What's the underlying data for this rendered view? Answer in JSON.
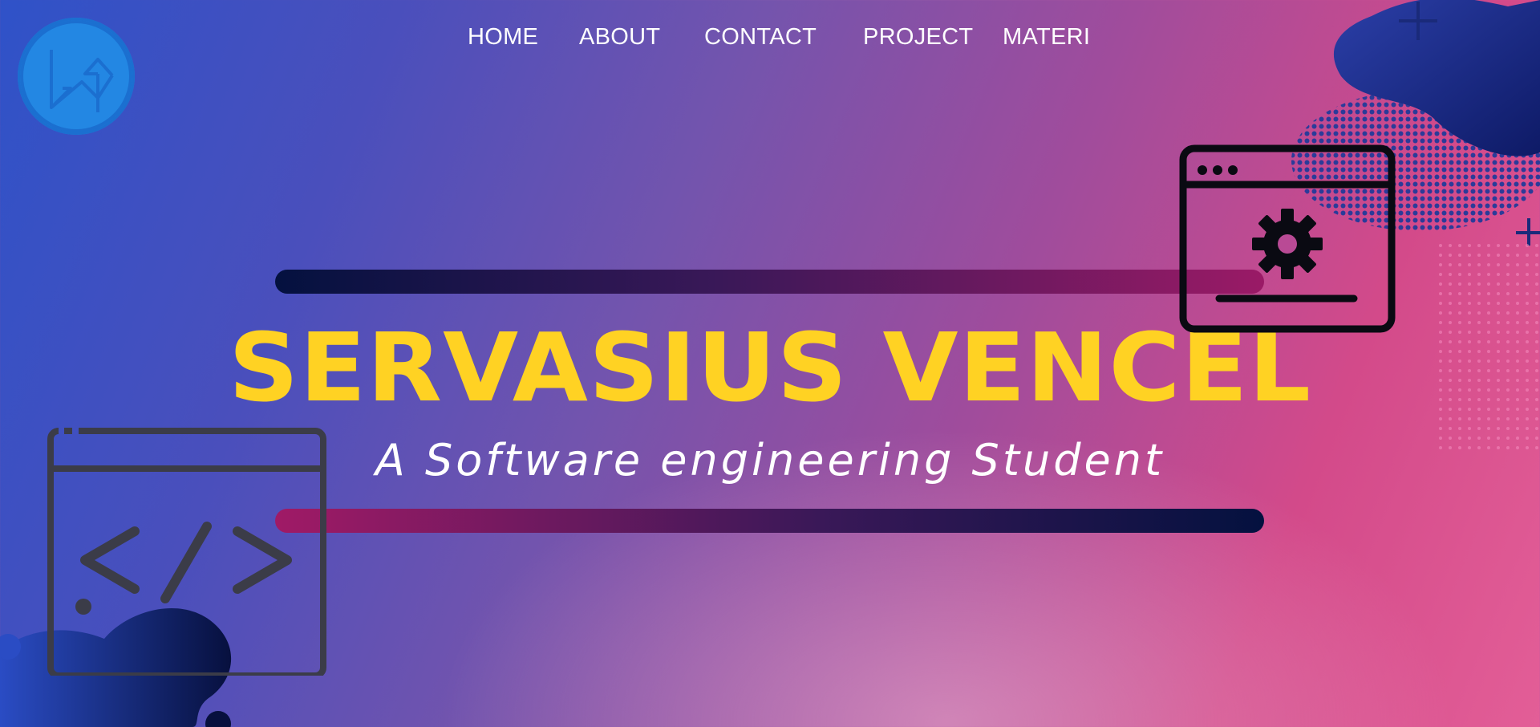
{
  "nav": {
    "items": [
      {
        "label": "HOME"
      },
      {
        "label": "ABOUT"
      },
      {
        "label": "CONTACT"
      },
      {
        "label": "PROJECT"
      },
      {
        "label": "MATERI"
      }
    ]
  },
  "hero": {
    "title": "SERVASIUS VENCEL",
    "subtitle": "A Software engineering Student"
  },
  "icons": {
    "logo": "sync-arrows-icon",
    "code_window": "code-window-icon",
    "settings_window": "settings-window-icon"
  },
  "colors": {
    "title": "#ffd223",
    "nav_text": "#ffffff",
    "logo_circle": "#2387e3",
    "bar_dark": "#04113f",
    "bar_magenta": "#9a1a66"
  }
}
